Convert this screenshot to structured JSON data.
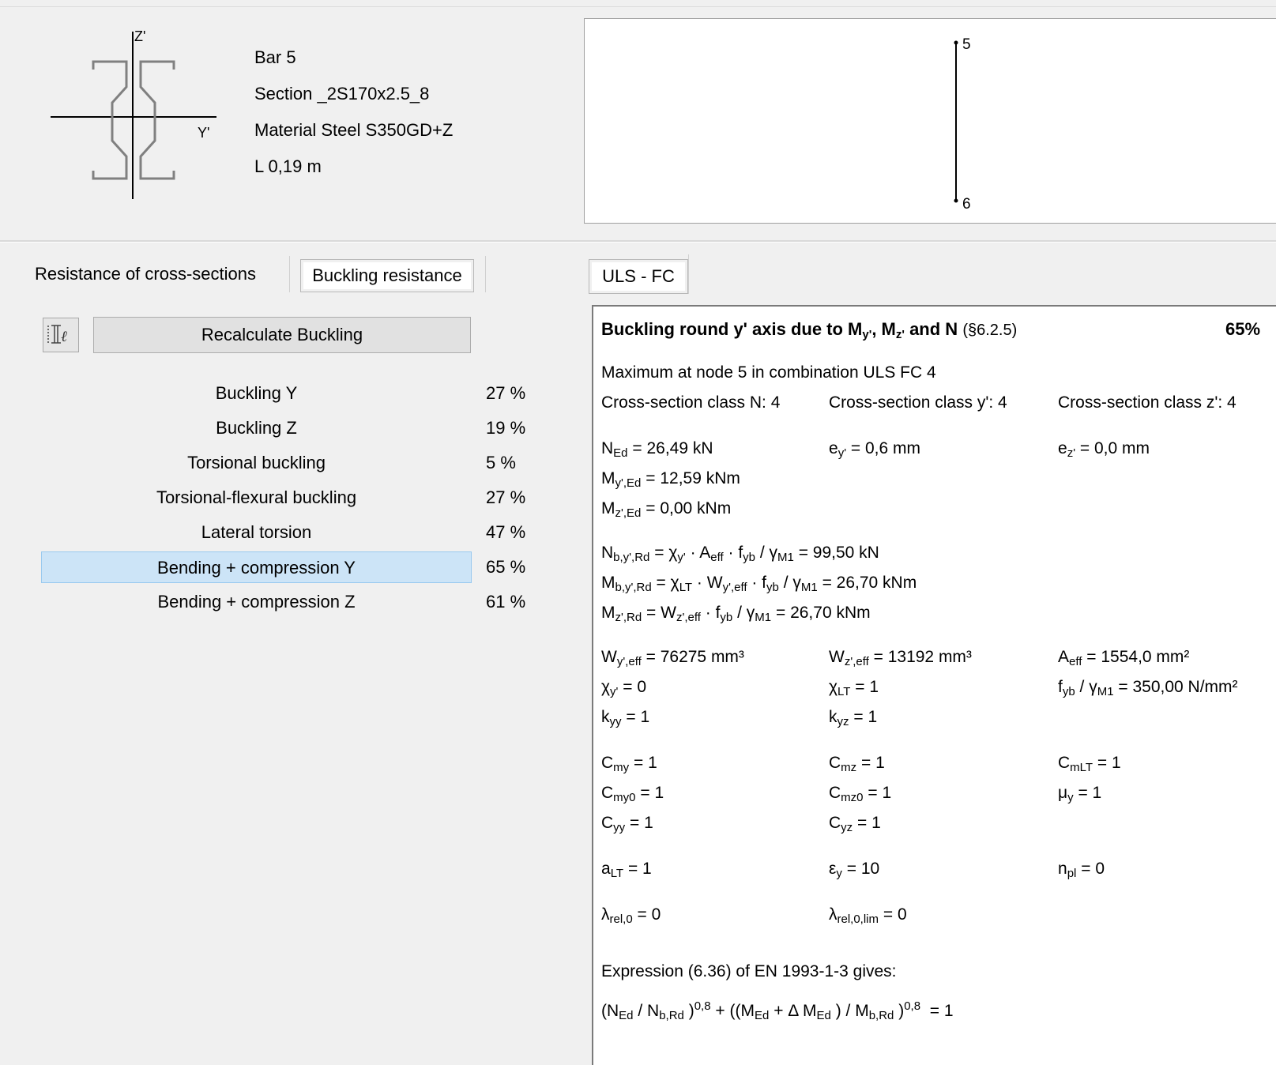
{
  "bar": {
    "bar": "Bar 5",
    "section": "Section _2S170x2.5_8",
    "material": "Material Steel S350GD+Z",
    "length": "L 0,19 m"
  },
  "section_axes": {
    "z": "Z'",
    "y": "Y'"
  },
  "preview": {
    "node_top": "5",
    "node_bottom": "6"
  },
  "tabs_left": {
    "cross_sections": "Resistance of cross-sections",
    "buckling": "Buckling resistance"
  },
  "toolbar": {
    "recalc_label": "Recalculate Buckling"
  },
  "checks": [
    {
      "label": "Buckling Y",
      "pct": "27 %"
    },
    {
      "label": "Buckling Z",
      "pct": "19 %"
    },
    {
      "label": "Torsional buckling",
      "pct": "5 %"
    },
    {
      "label": "Torsional-flexural buckling",
      "pct": "27 %"
    },
    {
      "label": "Lateral torsion",
      "pct": "47 %"
    },
    {
      "label": "Bending + compression Y",
      "pct": "65 %"
    },
    {
      "label": "Bending + compression Z",
      "pct": "61 %"
    }
  ],
  "selected_check": 5,
  "tabs_right": {
    "combo": "ULS - FC"
  },
  "report": {
    "heading_prefix": "Buckling round y' axis due to M",
    "heading_my": "y'",
    "heading_mid": ", M",
    "heading_mz": "z'",
    "heading_end": " and N",
    "heading_ref": "(§6.2.5)",
    "heading_pct": "65%",
    "maximum": "Maximum at node 5 in combination ULS FC 4",
    "class_n": "Cross-section class N: 4",
    "class_y": "Cross-section class y': 4",
    "class_z": "Cross-section class z': 4",
    "ned": "= 26,49 kN",
    "ey": "= 0,6 mm",
    "ez": "= 0,0 mm",
    "myed": "= 12,59 kNm",
    "mzed": "= 0,00 kNm",
    "nbrd": "= 99,50 kN",
    "mbrd": "= 26,70 kNm",
    "mzrd": "= 26,70 kNm",
    "wyeff": "= 76275 mm³",
    "wzeff": "= 13192 mm³",
    "aeff": "= 1554,0 mm²",
    "chiy": "= 0",
    "chilt": "= 1",
    "fyb_gamma": "= 350,00 N/mm²",
    "kyy": "= 1",
    "kyz": "= 1",
    "cmy": "= 1",
    "cmz": "= 1",
    "cmlt": "= 1",
    "cmy0": "= 1",
    "cmz0": "= 1",
    "muy": "= 1",
    "cyy": "= 1",
    "cyz": "= 1",
    "alt": "= 1",
    "epsy": "= 10",
    "npl": "= 0",
    "lrel0": "= 0",
    "lrel0lim": "= 0",
    "expression": "Expression (6.36) of EN 1993-1-3 gives:",
    "formula_result": "= 1"
  }
}
